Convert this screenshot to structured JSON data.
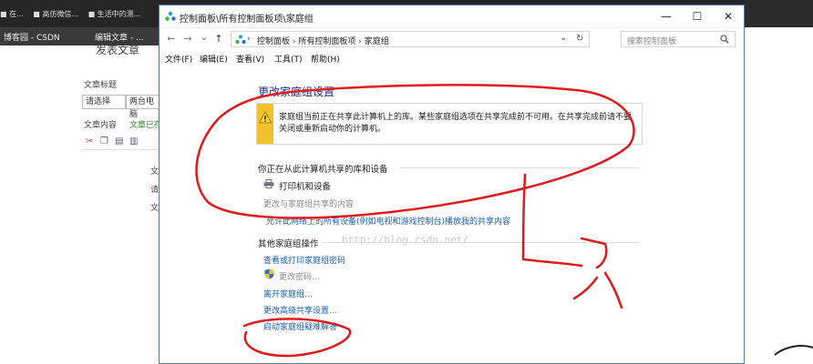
{
  "background": {
    "bookmarks": [
      "■ 在...",
      "■ 高仿微信...",
      "■ 生活中的测..."
    ],
    "tabs": [
      "博客园 - CSDN",
      "编辑文章 - ..."
    ],
    "form": {
      "heading": "发表文章",
      "article_title_label": "文章标题",
      "select_value": "请选择",
      "title_value": "两台电脑",
      "content_label": "文章内容",
      "content_tab": "文章已存",
      "field1": "文",
      "field2": "请",
      "field3": "文"
    }
  },
  "window": {
    "title": "控制面板\\所有控制面板项\\家庭组",
    "controls": {
      "minimize": "—",
      "maximize": "☐",
      "close": "✕"
    },
    "nav": {
      "back": "←",
      "forward": "→",
      "dropdown": "⌄",
      "up": "↑"
    },
    "address": {
      "crumb1": "控制面板",
      "crumb2": "所有控制面板项",
      "crumb3": "家庭组",
      "sep": "›",
      "dropdown": "⌄",
      "refresh": "↻"
    },
    "search": {
      "placeholder": "搜索控制面板"
    },
    "menu": [
      {
        "label": "文件(F)"
      },
      {
        "label": "编辑(E)"
      },
      {
        "label": "查看(V)"
      },
      {
        "label": "工具(T)"
      },
      {
        "label": "帮助(H)"
      }
    ],
    "page_title": "更改家庭组设置",
    "warning": "家庭组当前正在共享此计算机上的库。某些家庭组选项在共享完成前不可用。在共享完成前请不要关闭或重新启动你的计算机。",
    "sharing_section": {
      "title": "你正在从此计算机共享的库和设备",
      "printer": "打印机和设备",
      "change_link": "更改与家庭组共享的内容",
      "allow_link": "允许此网络上的所有设备(例如电视和游戏控制台)播放我的共享内容"
    },
    "other_section": {
      "title": "其他家庭组操作",
      "links": [
        "查看或打印家庭组密码",
        "更改密码...",
        "离开家庭组...",
        "更改高级共享设置...",
        "启动家庭组疑难解答"
      ]
    },
    "watermark": "http://blog.csdn.net/"
  },
  "colors": {
    "title_blue": "#1e3287",
    "link_blue": "#1a5fb4",
    "warning_yellow": "#f2c12e",
    "annotation_red": "#e01a1a"
  }
}
